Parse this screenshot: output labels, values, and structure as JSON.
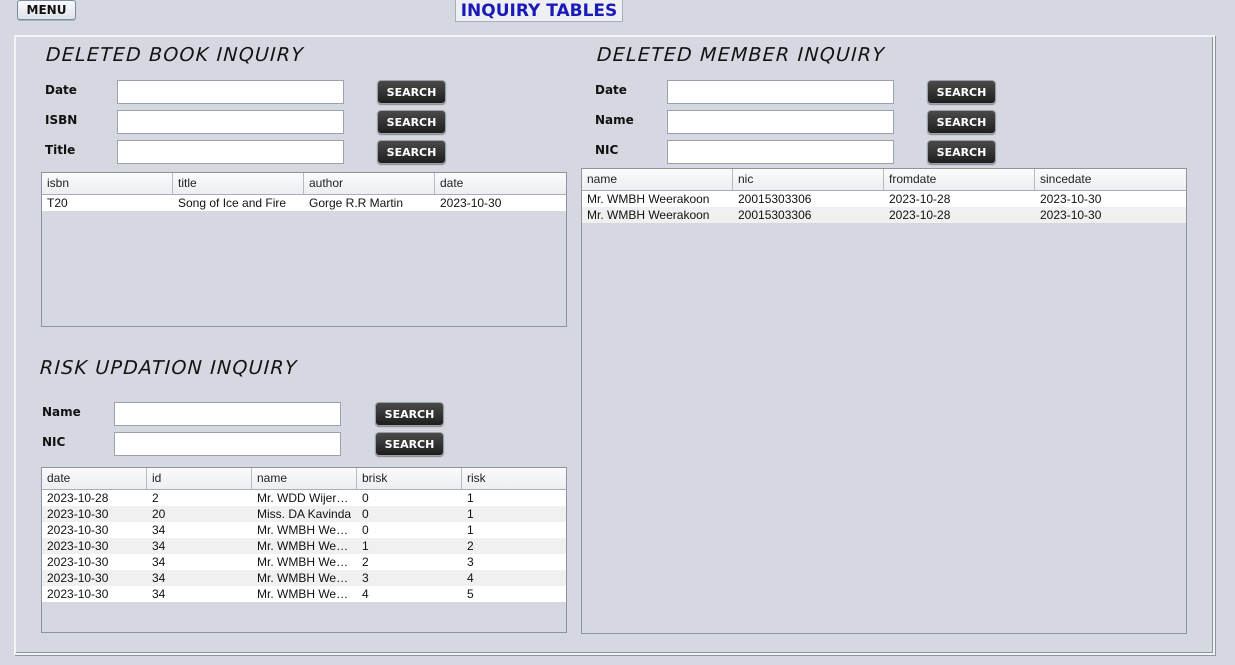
{
  "header": {
    "menu_label": "MENU",
    "page_title": "INQUIRY TABLES"
  },
  "book_inquiry": {
    "title": "DELETED BOOK INQUIRY",
    "search_label": "SEARCH",
    "fields": [
      {
        "label": "Date",
        "value": ""
      },
      {
        "label": "ISBN",
        "value": ""
      },
      {
        "label": "Title",
        "value": ""
      }
    ],
    "columns": [
      "isbn",
      "title",
      "author",
      "date"
    ],
    "rows": [
      [
        "T20",
        "Song of Ice and Fire",
        "Gorge R.R Martin",
        "2023-10-30"
      ]
    ]
  },
  "member_inquiry": {
    "title": "DELETED MEMBER INQUIRY",
    "search_label": "SEARCH",
    "fields": [
      {
        "label": "Date",
        "value": ""
      },
      {
        "label": "Name",
        "value": ""
      },
      {
        "label": "NIC",
        "value": ""
      }
    ],
    "columns": [
      "name",
      "nic",
      "fromdate",
      "sincedate"
    ],
    "rows": [
      [
        "Mr. WMBH Weerakoon",
        "20015303306",
        "2023-10-28",
        "2023-10-30"
      ],
      [
        "Mr. WMBH Weerakoon",
        "20015303306",
        "2023-10-28",
        "2023-10-30"
      ]
    ]
  },
  "risk_inquiry": {
    "title": "RISK UPDATION INQUIRY",
    "search_label": "SEARCH",
    "fields": [
      {
        "label": "Name",
        "value": ""
      },
      {
        "label": "NIC",
        "value": ""
      }
    ],
    "columns": [
      "date",
      "id",
      "name",
      "brisk",
      "risk"
    ],
    "rows": [
      [
        "2023-10-28",
        "2",
        "Mr. WDD Wijera...",
        "0",
        "1"
      ],
      [
        "2023-10-30",
        "20",
        "Miss. DA Kavinda",
        "0",
        "1"
      ],
      [
        "2023-10-30",
        "34",
        "Mr. WMBH Wee...",
        "0",
        "1"
      ],
      [
        "2023-10-30",
        "34",
        "Mr. WMBH Wee...",
        "1",
        "2"
      ],
      [
        "2023-10-30",
        "34",
        "Mr. WMBH Wee...",
        "2",
        "3"
      ],
      [
        "2023-10-30",
        "34",
        "Mr. WMBH Wee...",
        "3",
        "4"
      ],
      [
        "2023-10-30",
        "34",
        "Mr. WMBH Wee...",
        "4",
        "5"
      ]
    ]
  }
}
